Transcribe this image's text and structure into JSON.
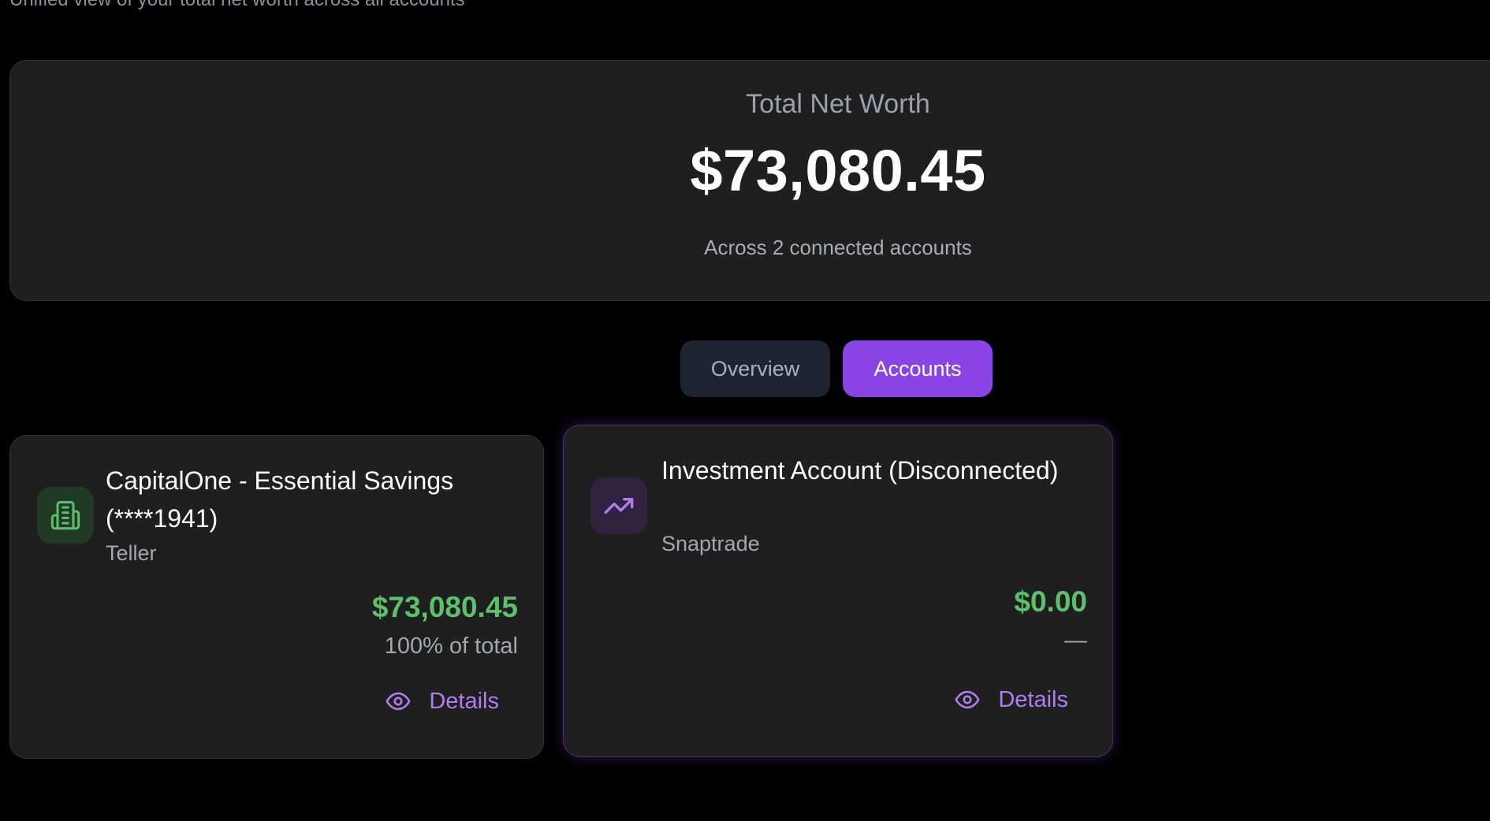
{
  "header": {
    "subtitle": "Unified view of your total net worth across all accounts"
  },
  "summary": {
    "label": "Total Net Worth",
    "value": "$73,080.45",
    "subtext": "Across 2 connected accounts"
  },
  "tabs": [
    {
      "label": "Overview",
      "active": false
    },
    {
      "label": "Accounts",
      "active": true
    }
  ],
  "accounts": [
    {
      "icon": "building-icon",
      "name": "CapitalOne - Essential Savings (****1941)",
      "provider": "Teller",
      "balance": "$73,080.45",
      "share": "100% of total",
      "details_label": "Details"
    },
    {
      "icon": "trending-up-icon",
      "name": "Investment Account (Disconnected)",
      "provider": "Snaptrade",
      "balance": "$0.00",
      "share": "—",
      "details_label": "Details"
    }
  ],
  "colors": {
    "background": "#000000",
    "card": "#1f1f1f",
    "accent": "#8a44e6",
    "positive": "#5dc06b",
    "link": "#b07ef0"
  }
}
